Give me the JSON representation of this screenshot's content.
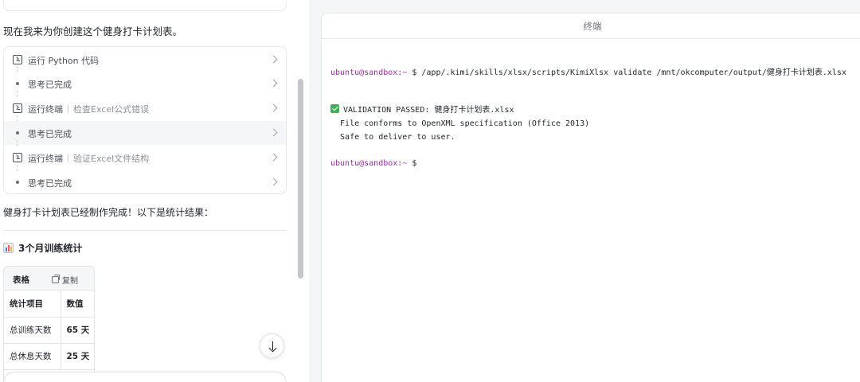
{
  "left": {
    "intro": "现在我来为你创建这个健身打卡计划表。",
    "steps": [
      {
        "icon": "terminal-icon",
        "label": "运行 Python 代码",
        "sub": ""
      },
      {
        "icon": "dot-icon",
        "label": "思考已完成",
        "sub": ""
      },
      {
        "icon": "terminal-icon",
        "label": "运行终端",
        "sub": "检查Excel公式错误"
      },
      {
        "icon": "dot-icon",
        "label": "思考已完成",
        "sub": ""
      },
      {
        "icon": "terminal-icon",
        "label": "运行终端",
        "sub": "验证Excel文件结构"
      },
      {
        "icon": "dot-icon",
        "label": "思考已完成",
        "sub": ""
      }
    ],
    "done_text": "健身打卡计划表已经制作完成！以下是统计结果：",
    "stats_title": "3个月训练统计",
    "table": {
      "tab_label": "表格",
      "copy_label": "复制",
      "headers": [
        "统计项目",
        "数值"
      ],
      "rows": [
        [
          "总训练天数",
          "65 天"
        ],
        [
          "总休息天数",
          "25 天"
        ]
      ]
    }
  },
  "right": {
    "title": "终端",
    "prompt": "ubuntu@sandbox:~",
    "command": " $ /app/.kimi/skills/xlsx/scripts/KimiXlsx validate /mnt/okcomputer/output/健身打卡计划表.xlsx",
    "output": [
      "VALIDATION PASSED: 健身打卡计划表.xlsx",
      "  File conforms to OpenXML specification (Office 2013)",
      "  Safe to deliver to user."
    ],
    "prompt_end": " $"
  },
  "colors": {
    "prompt": "#9c2aa6",
    "check": "#3fb05a",
    "panel_bg": "#f4f5f7"
  }
}
